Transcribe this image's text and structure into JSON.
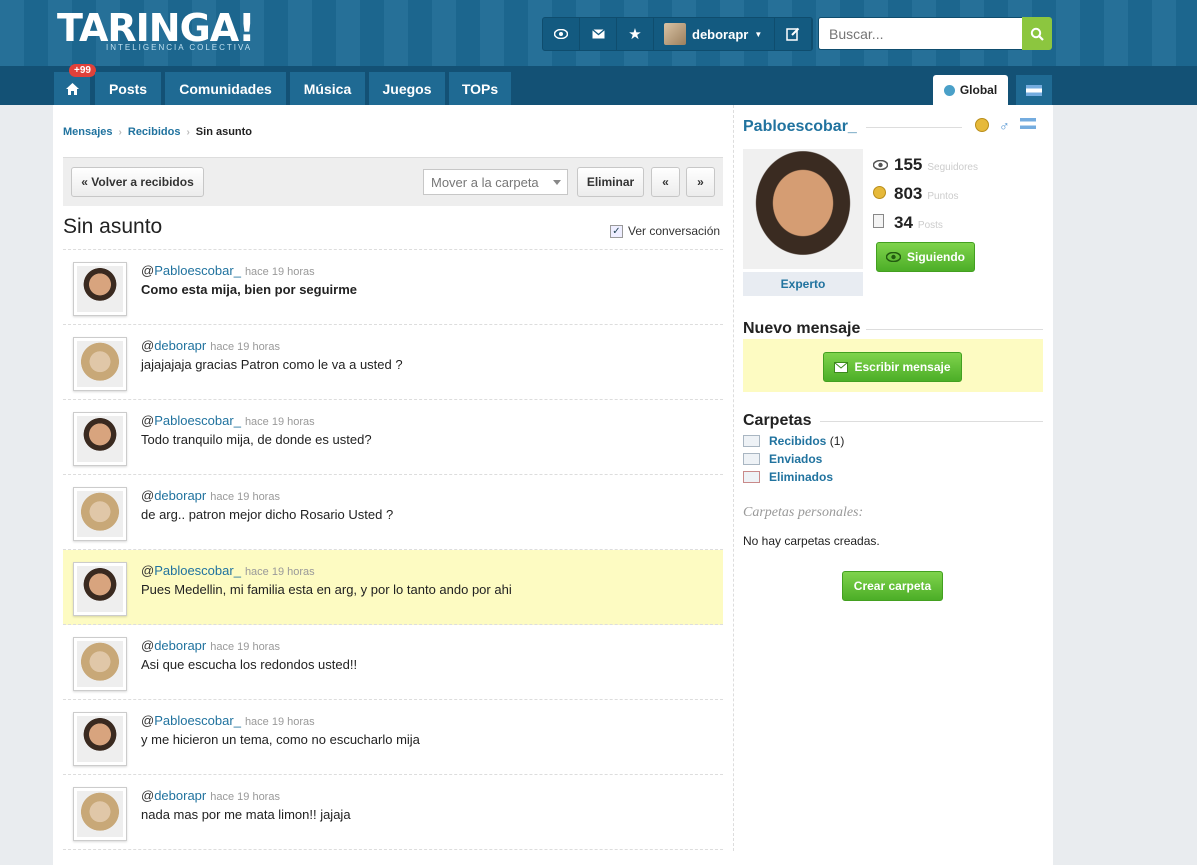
{
  "header": {
    "logo": "TARINGA!",
    "tagline": "INTELIGENCIA COLECTIVA",
    "username": "deborapr",
    "search_placeholder": "Buscar..."
  },
  "nav": {
    "badge": "+99",
    "items": [
      "Posts",
      "Comunidades",
      "Música",
      "Juegos",
      "TOPs"
    ],
    "global": "Global"
  },
  "breadcrumb": [
    "Mensajes",
    "Recibidos",
    "Sin asunto"
  ],
  "toolbar": {
    "back": "« Volver a recibidos",
    "move_placeholder": "Mover a la carpeta",
    "delete": "Eliminar",
    "prev": "«",
    "next": "»"
  },
  "subject": "Sin asunto",
  "view_conversation": "Ver conversación",
  "messages": [
    {
      "author": "Pabloescobar_",
      "time": "hace 19 horas",
      "text": "Como esta mija, bien por seguirme"
    },
    {
      "author": "deborapr",
      "time": "hace 19 horas",
      "text": "jajajajaja gracias Patron como le va a usted ?"
    },
    {
      "author": "Pabloescobar_",
      "time": "hace 19 horas",
      "text": "Todo tranquilo mija, de donde es usted?"
    },
    {
      "author": "deborapr",
      "time": "hace 19 horas",
      "text": "de arg.. patron mejor dicho Rosario Usted ?"
    },
    {
      "author": "Pabloescobar_",
      "time": "hace 19 horas",
      "text": "Pues Medellin, mi familia esta en arg, y por lo tanto ando por ahi"
    },
    {
      "author": "deborapr",
      "time": "hace 19 horas",
      "text": "Asi que escucha los redondos usted!!"
    },
    {
      "author": "Pabloescobar_",
      "time": "hace 19 horas",
      "text": "y me hicieron un tema, como no escucharlo mija"
    },
    {
      "author": "deborapr",
      "time": "hace 19 horas",
      "text": "nada mas por me mata limon!! jajaja"
    }
  ],
  "profile": {
    "name": "Pabloescobar_",
    "rank": "Experto",
    "followers": "155",
    "followers_label": "Seguidores",
    "points": "803",
    "points_label": "Puntos",
    "posts": "34",
    "posts_label": "Posts",
    "following_button": "Siguiendo"
  },
  "new_message": {
    "title": "Nuevo mensaje",
    "button": "Escribir mensaje"
  },
  "folders": {
    "title": "Carpetas",
    "items": [
      {
        "label": "Recibidos",
        "count": "(1)"
      },
      {
        "label": "Enviados",
        "count": ""
      },
      {
        "label": "Eliminados",
        "count": ""
      }
    ],
    "personal_title": "Carpetas personales:",
    "empty": "No hay carpetas creadas.",
    "create_button": "Crear carpeta"
  }
}
